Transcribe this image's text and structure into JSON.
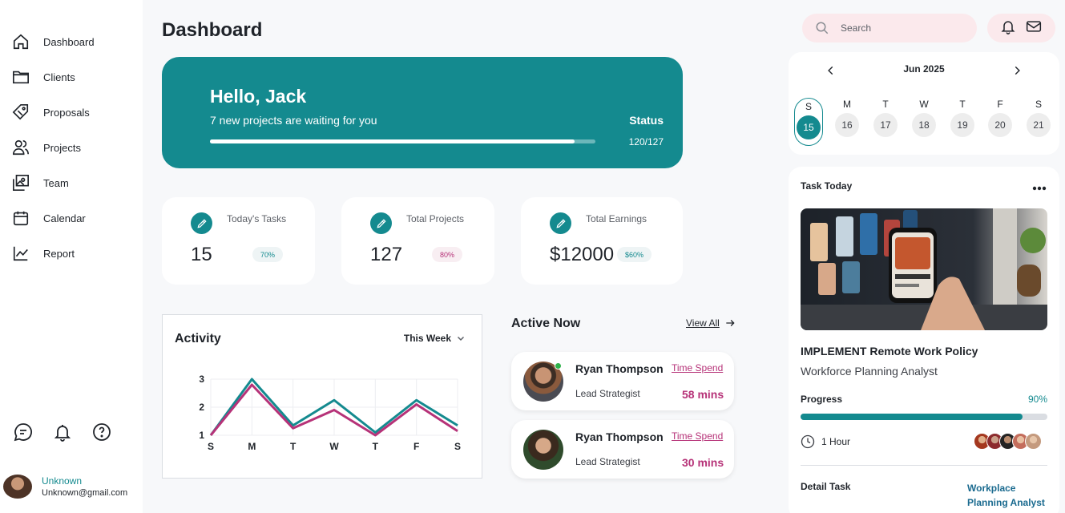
{
  "sidebar": {
    "items": [
      {
        "label": "Dashboard",
        "icon": "home-icon"
      },
      {
        "label": "Clients",
        "icon": "folder-icon"
      },
      {
        "label": "Proposals",
        "icon": "tag-icon"
      },
      {
        "label": "Projects",
        "icon": "users-icon"
      },
      {
        "label": "Team",
        "icon": "team-images-icon"
      },
      {
        "label": "Calendar",
        "icon": "calendar-icon"
      },
      {
        "label": "Report",
        "icon": "chart-line-icon"
      }
    ],
    "user": {
      "name": "Unknown",
      "email": "Unknown@gmail.com"
    }
  },
  "header": {
    "title": "Dashboard"
  },
  "hero": {
    "greeting": "Hello, Jack",
    "message": "7 new projects are waiting for you",
    "status_label": "Status",
    "status_count": "120/127",
    "progress": 0.945
  },
  "stats": [
    {
      "title": "Today's Tasks",
      "value": "15",
      "badge": "70%",
      "badge_color": "#148a8f",
      "badge_bg": "#eef4f5"
    },
    {
      "title": "Total Projects",
      "value": "127",
      "badge": "80%",
      "badge_color": "#b63278",
      "badge_bg": "#f8eef2"
    },
    {
      "title": "Total Earnings",
      "value": "$12000",
      "badge": "$60%",
      "badge_color": "#148a8f",
      "badge_bg": "#eef4f5"
    }
  ],
  "activity": {
    "title": "Activity",
    "range": "This Week"
  },
  "chart_data": {
    "type": "line",
    "categories": [
      "S",
      "M",
      "T",
      "W",
      "T",
      "F",
      "S"
    ],
    "ylim": [
      1,
      3
    ],
    "yticks": [
      "1",
      "2",
      "3"
    ],
    "series": [
      {
        "color": "#148a8f",
        "values": [
          1.0,
          3.0,
          1.35,
          2.25,
          1.1,
          2.25,
          1.35
        ]
      },
      {
        "color": "#b63278",
        "values": [
          1.0,
          2.8,
          1.25,
          1.9,
          1.0,
          2.1,
          1.15
        ]
      }
    ]
  },
  "active_now": {
    "title": "Active Now",
    "view_all": "View All",
    "people": [
      {
        "name": "Ryan Thompson",
        "role": "Lead Strategist",
        "link": "Time Spend",
        "time": "58 mins"
      },
      {
        "name": "Ryan Thompson",
        "role": "Lead Strategist",
        "link": "Time Spend",
        "time": "30 mins"
      }
    ]
  },
  "search": {
    "placeholder": "Search"
  },
  "calendar": {
    "month": "Jun 2025",
    "days": [
      {
        "label": "S",
        "num": "15",
        "selected": true
      },
      {
        "label": "M",
        "num": "16"
      },
      {
        "label": "T",
        "num": "17"
      },
      {
        "label": "W",
        "num": "18"
      },
      {
        "label": "T",
        "num": "19"
      },
      {
        "label": "F",
        "num": "20"
      },
      {
        "label": "S",
        "num": "21"
      }
    ]
  },
  "task": {
    "heading": "Task Today",
    "name": "IMPLEMENT Remote Work Policy",
    "subtitle": "Workforce Planning Analyst",
    "progress_label": "Progress",
    "progress_pct": "90%",
    "progress": 0.9,
    "duration": "1 Hour",
    "detail_label": "Detail Task",
    "detail_value": "Workplace Planning Analyst"
  },
  "colors": {
    "accent": "#148a8f",
    "pink": "#b63278"
  }
}
